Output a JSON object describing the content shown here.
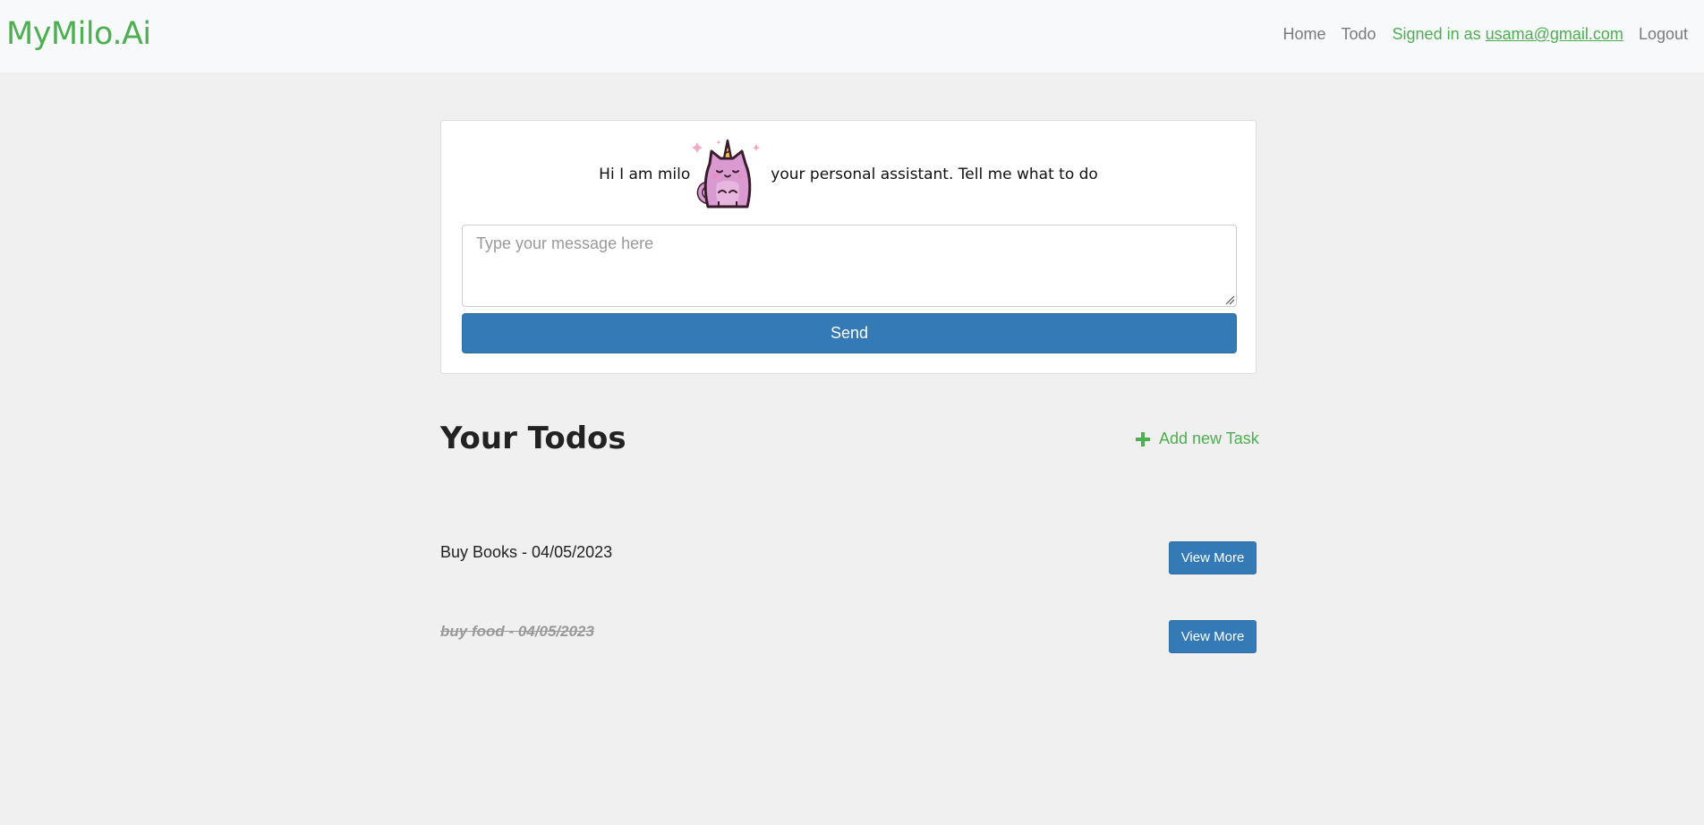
{
  "navbar": {
    "brand": "MyMilo.Ai",
    "links": [
      "Home",
      "Todo"
    ],
    "signed_in_prefix": "Signed in as ",
    "user_email": "usama@gmail.com",
    "logout": "Logout"
  },
  "assistant": {
    "greeting_before": "Hi I am milo",
    "greeting_after": "your personal assistant. Tell me what to do",
    "mascot_icon": "unicorn-cat-icon",
    "message_placeholder": "Type your message here",
    "message_value": "",
    "send_label": "Send"
  },
  "todos": {
    "title": "Your Todos",
    "add_label": "Add new Task",
    "items": [
      {
        "title": "Buy Books",
        "date": "04/05/2023",
        "label": "Buy Books - 04/05/2023",
        "completed": false,
        "action": "View More"
      },
      {
        "title": "buy food",
        "date": "04/05/2023",
        "label": "buy food - 04/05/2023",
        "completed": true,
        "action": "View More"
      }
    ]
  },
  "colors": {
    "brand_green": "#4caf50",
    "primary_blue": "#337ab7",
    "page_bg": "#f0f0f0"
  }
}
